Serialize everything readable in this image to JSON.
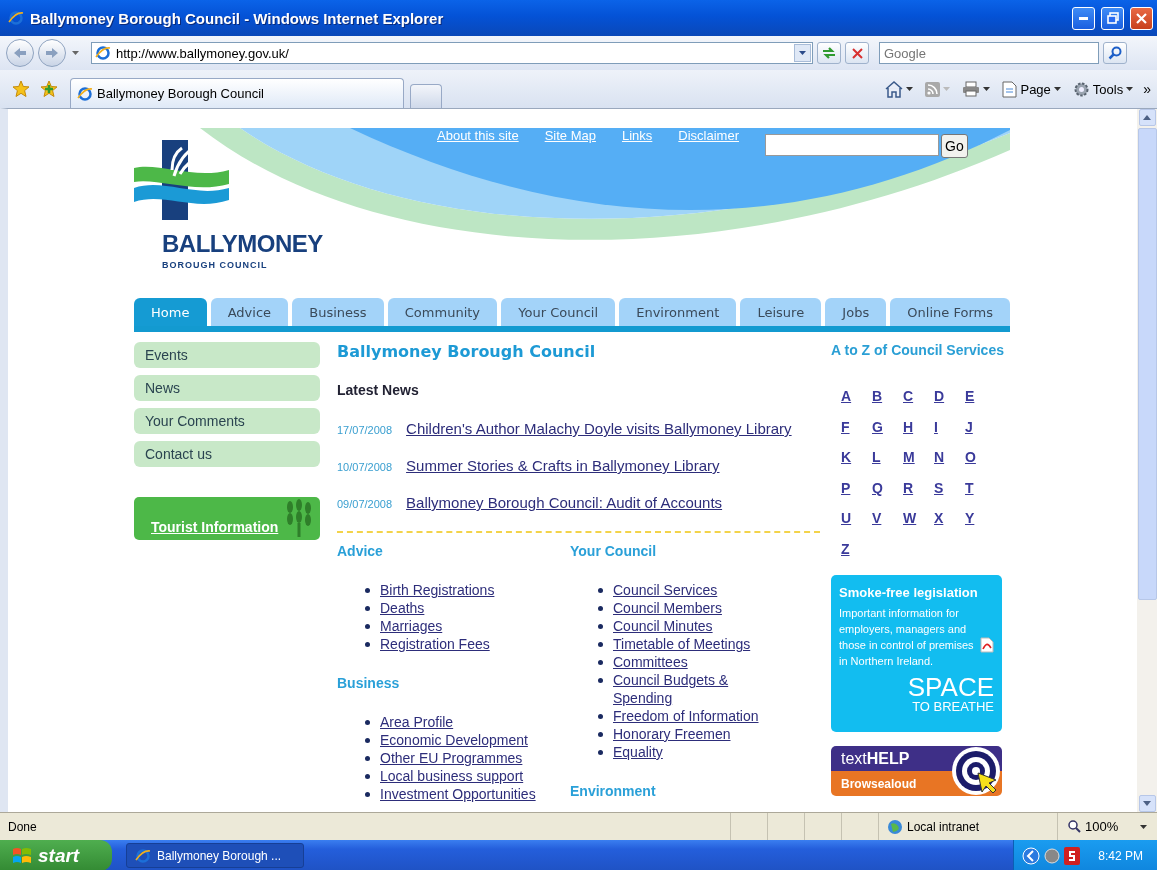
{
  "window": {
    "title": "Ballymoney Borough Council - Windows Internet Explorer"
  },
  "address_bar": {
    "url": "http://www.ballymoney.gov.uk/"
  },
  "search_box": {
    "placeholder": "Google"
  },
  "tabs": [
    {
      "label": "Ballymoney Borough Council",
      "selected": true
    }
  ],
  "command_bar": {
    "page": "Page",
    "tools": "Tools",
    "overflow": "»"
  },
  "page": {
    "top_links": [
      "About this site",
      "Site Map",
      "Links",
      "Disclaimer"
    ],
    "site_search": {
      "button": "Go"
    },
    "logo": {
      "name": "BALLYMONEY",
      "subtitle": "BOROUGH COUNCIL"
    },
    "nav_tabs": [
      {
        "label": "Home",
        "selected": true
      },
      {
        "label": "Advice",
        "selected": false
      },
      {
        "label": "Business",
        "selected": false
      },
      {
        "label": "Community",
        "selected": false
      },
      {
        "label": "Your Council",
        "selected": false
      },
      {
        "label": "Environment",
        "selected": false
      },
      {
        "label": "Leisure",
        "selected": false
      },
      {
        "label": "Jobs",
        "selected": false
      },
      {
        "label": "Online Forms",
        "selected": false
      }
    ],
    "side_menu": [
      "Events",
      "News",
      "Your Comments",
      "Contact us"
    ],
    "tourist_banner": "Tourist Information",
    "heading": "Ballymoney Borough Council",
    "latest_news": {
      "title": "Latest News",
      "items": [
        {
          "date": "17/07/2008",
          "title": "Children's Author Malachy Doyle visits Ballymoney Library"
        },
        {
          "date": "10/07/2008",
          "title": "Summer Stories & Crafts in Ballymoney Library"
        },
        {
          "date": "09/07/2008",
          "title": "Ballymoney Borough Council: Audit of Accounts"
        }
      ]
    },
    "section_columns": [
      [
        {
          "title": "Advice",
          "links": [
            "Birth Registrations",
            "Deaths",
            "Marriages",
            "Registration Fees"
          ]
        },
        {
          "title": "Business",
          "links": [
            "Area Profile",
            "Economic Development",
            "Other EU Programmes",
            "Local business support",
            "Investment Opportunities"
          ]
        }
      ],
      [
        {
          "title": "Your Council",
          "links": [
            "Council Services",
            "Council Members",
            "Council Minutes",
            "Timetable of Meetings",
            "Committees",
            "Council Budgets & Spending",
            "Freedom of Information",
            "Honorary Freemen",
            "Equality"
          ]
        },
        {
          "title": "Environment"
        }
      ]
    ],
    "a_to_z": {
      "title": "A to Z of Council Services",
      "letters": [
        "A",
        "B",
        "C",
        "D",
        "E",
        "F",
        "G",
        "H",
        "I",
        "J",
        "K",
        "L",
        "M",
        "N",
        "O",
        "P",
        "Q",
        "R",
        "S",
        "T",
        "U",
        "V",
        "W",
        "X",
        "Y",
        "Z"
      ]
    },
    "smoke_free": {
      "title": "Smoke-free legislation",
      "text": "Important information for employers, managers and those in control of premises in Northern Ireland.",
      "brand": "SPACE",
      "tagline": "TO BREATHE"
    },
    "browsealoud": {
      "brand": "text**HELP**",
      "label": "Browsealoud"
    }
  },
  "status_bar": {
    "text": "Done",
    "zone": "Local intranet",
    "zoom": "100%"
  },
  "taskbar": {
    "start": "start",
    "tasks": [
      "Ballymoney Borough ..."
    ],
    "clock": "8:42 PM"
  }
}
